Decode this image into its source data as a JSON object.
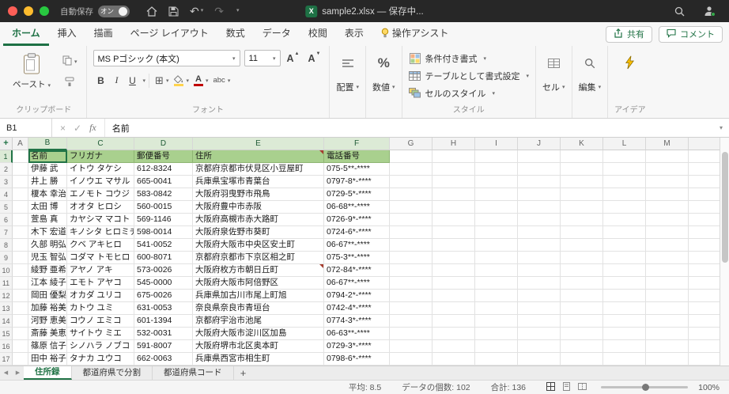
{
  "colors": {
    "accent_green": "#217346",
    "titlebar_bg": "#272727",
    "table_header_fill": "#A9D08E",
    "selected_header_tint": "#DCEAD6"
  },
  "icons": {
    "chevron": "▾",
    "undo": "↶",
    "redo": "↷",
    "borders": "⊞",
    "cancel": "×",
    "enter": "✓",
    "fx": "fx",
    "plus": "+",
    "left_arrow": "◀",
    "right_arrow": "▶",
    "add_sheet": "+",
    "triangle_up": "▲",
    "triangle_down": "▼",
    "excel_logo": "X"
  },
  "titlebar": {
    "autosave_label": "自動保存",
    "autosave_state": "オン",
    "filename": "sample2.xlsx — 保存中..."
  },
  "ribbon": {
    "tabs": [
      "ホーム",
      "挿入",
      "描画",
      "ページ レイアウト",
      "数式",
      "データ",
      "校閲",
      "表示",
      "操作アシスト"
    ],
    "active_tab": "ホーム",
    "assist_tab": "操作アシスト",
    "share_label": "共有",
    "comments_label": "コメント",
    "paste_label": "ペースト",
    "font_name": "MS Pゴシック (本文)",
    "font_size": "11",
    "bold": "B",
    "italic": "I",
    "underline": "U",
    "phonetic_label": "abc",
    "alignment_label": "配置",
    "number_label": "数値",
    "percent_symbol": "%",
    "conditional_label": "条件付き書式",
    "format_table_label": "テーブルとして書式設定",
    "cell_styles_label": "セルのスタイル",
    "cells_label": "セル",
    "editing_label": "編集",
    "group_labels": {
      "clipboard": "クリップボード",
      "font": "フォント",
      "style": "スタイル",
      "ideas": "アイデア"
    }
  },
  "formula_bar": {
    "name_box": "B1",
    "content": "名前"
  },
  "grid": {
    "columns": [
      "A",
      "B",
      "C",
      "D",
      "E",
      "F",
      "G",
      "H",
      "I",
      "J",
      "K",
      "L",
      "M"
    ],
    "visible_rows": 17,
    "active_cell": "B1",
    "selected_columns": [
      "B",
      "C",
      "D",
      "E",
      "F"
    ],
    "data_columns": [
      "B",
      "C",
      "D",
      "E",
      "F"
    ],
    "header_row": [
      "名前",
      "フリガナ",
      "郵便番号",
      "住所",
      "電話番号"
    ],
    "rows": [
      [
        "伊藤 武",
        "イトウ タケシ",
        "612-8324",
        "京都府京都市伏見区小豆屋町",
        "075-5**-****"
      ],
      [
        "井上 勝",
        "イノウエ マサル",
        "665-0041",
        "兵庫県宝塚市青葉台",
        "0797-8*-****"
      ],
      [
        "榎本 幸治",
        "エノモト コウジ",
        "583-0842",
        "大阪府羽曳野市飛鳥",
        "0729-5*-****"
      ],
      [
        "太田 博",
        "オオタ ヒロシ",
        "560-0015",
        "大阪府豊中市赤阪",
        "06-68**-****"
      ],
      [
        "萱島 真",
        "カヤシマ マコト",
        "569-1146",
        "大阪府高槻市赤大路町",
        "0726-9*-****"
      ],
      [
        "木下 宏道",
        "キノシタ ヒロミチ",
        "598-0014",
        "大阪府泉佐野市葵町",
        "0724-6*-****"
      ],
      [
        "久部 明弘",
        "クベ アキヒロ",
        "541-0052",
        "大阪府大阪市中央区安土町",
        "06-67**-****"
      ],
      [
        "児玉 智弘",
        "コダマ トモヒロ",
        "600-8071",
        "京都府京都市下京区相之町",
        "075-3**-****"
      ],
      [
        "綾野 亜希",
        "アヤノ アキ",
        "573-0026",
        "大阪府枚方市朝日丘町",
        "072-84*-****"
      ],
      [
        "江本 綾子",
        "エモト アヤコ",
        "545-0000",
        "大阪府大阪市阿倍野区",
        "06-67**-****"
      ],
      [
        "岡田 優梨子",
        "オカダ ユリコ",
        "675-0026",
        "兵庫県加古川市尾上町旭",
        "0794-2*-****"
      ],
      [
        "加藤 裕美",
        "カトウ ユミ",
        "631-0053",
        "奈良県奈良市青垣台",
        "0742-4*-****"
      ],
      [
        "河野 恵美子",
        "コウノ エミコ",
        "601-1394",
        "京都府宇治市池尾",
        "0774-3*-****"
      ],
      [
        "斎藤 美恵",
        "サイトウ ミエ",
        "532-0031",
        "大阪府大阪市淀川区加島",
        "06-63**-****"
      ],
      [
        "篠原 信子",
        "シノハラ ノブコ",
        "591-8007",
        "大阪府堺市北区奥本町",
        "0729-3*-****"
      ],
      [
        "田中 裕子",
        "タナカ ユウコ",
        "662-0063",
        "兵庫県西宮市相生町",
        "0798-6*-****"
      ]
    ],
    "comment_cells": [
      "E1",
      "E10"
    ]
  },
  "sheet_bar": {
    "tabs": [
      "住所録",
      "都道府県で分割",
      "都道府県コード"
    ],
    "active_tab": "住所録"
  },
  "status_bar": {
    "average": "平均: 8.5",
    "count": "データの個数: 102",
    "sum": "合計: 136",
    "zoom": "100%"
  }
}
